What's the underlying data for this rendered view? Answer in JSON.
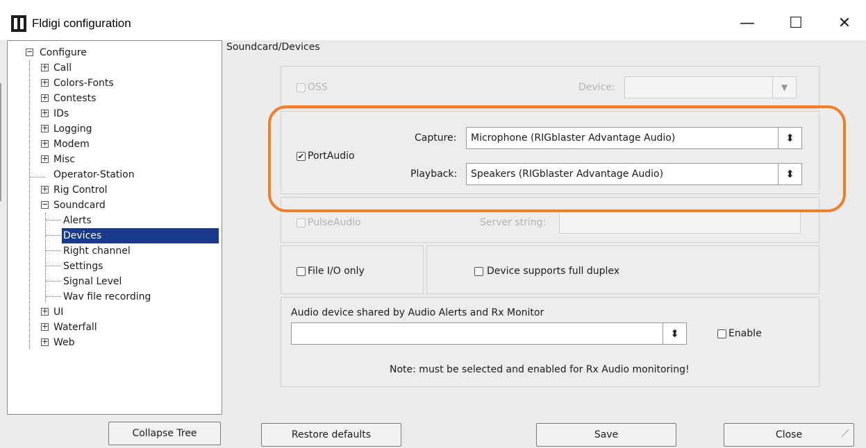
{
  "window": {
    "title": "Fldigi configuration",
    "min_glyph": "—",
    "max_glyph": "☐",
    "close_glyph": "✕"
  },
  "tree": {
    "toggle_collapsed": "+",
    "toggle_expanded": "−",
    "items": [
      {
        "label": "Configure"
      },
      {
        "label": "Call"
      },
      {
        "label": "Colors-Fonts"
      },
      {
        "label": "Contests"
      },
      {
        "label": "IDs"
      },
      {
        "label": "Logging"
      },
      {
        "label": "Modem"
      },
      {
        "label": "Misc"
      },
      {
        "label": "Operator-Station"
      },
      {
        "label": "Rig Control"
      },
      {
        "label": "Soundcard"
      },
      {
        "label": "Alerts"
      },
      {
        "label": "Devices"
      },
      {
        "label": "Right channel"
      },
      {
        "label": "Settings"
      },
      {
        "label": "Signal Level"
      },
      {
        "label": "Wav file recording"
      },
      {
        "label": "UI"
      },
      {
        "label": "Waterfall"
      },
      {
        "label": "Web"
      }
    ],
    "selected": "Devices"
  },
  "section_title": "Soundcard/Devices",
  "oss": {
    "label": "OSS",
    "checked": false,
    "device_label": "Device:",
    "device_value": "",
    "combo_arrow": "▼"
  },
  "portaudio": {
    "label": "PortAudio",
    "checked": true,
    "check_glyph": "✔",
    "capture_label": "Capture:",
    "capture_value": "Microphone (RIGblaster Advantage Audio)",
    "playback_label": "Playback:",
    "playback_value": "Speakers (RIGblaster Advantage Audio)",
    "spin_glyph": "⬍"
  },
  "pulseaudio": {
    "label": "PulseAudio",
    "checked": false,
    "server_label": "Server string:",
    "server_value": ""
  },
  "fileio": {
    "label": "File I/O only",
    "checked": false
  },
  "duplex": {
    "label": "Device supports full duplex",
    "checked": false
  },
  "audio_shared": {
    "label": "Audio device shared by Audio Alerts and Rx Monitor",
    "value": "",
    "spin_glyph": "⬍",
    "enable_label": "Enable",
    "enable_checked": false,
    "note": "Note: must be selected and enabled for Rx Audio monitoring!"
  },
  "buttons": {
    "collapse_tree": "Collapse Tree",
    "restore_defaults": "Restore defaults",
    "save": "Save",
    "close": "Close"
  },
  "colors": {
    "highlight": "#ef7f2a",
    "selection": "#1a3a8c"
  }
}
